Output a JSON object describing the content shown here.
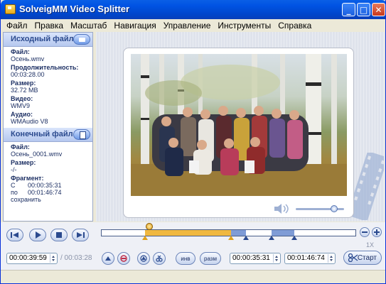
{
  "window": {
    "title": "SolveigMM Video Splitter",
    "controls": {
      "minimize": "_",
      "maximize": "□",
      "close": "✕"
    }
  },
  "menu": [
    "Файл",
    "Правка",
    "Масштаб",
    "Навигация",
    "Управление",
    "Инструменты",
    "Справка"
  ],
  "source": {
    "header": "Исходный файл",
    "file_label": "Файл:",
    "file_value": "Осень.wmv",
    "duration_label": "Продолжительность:",
    "duration_value": "00:03:28.00",
    "size_label": "Размер:",
    "size_value": "32.72 MB",
    "video_label": "Видео:",
    "video_value": "WMV9",
    "audio_label": "Аудио:",
    "audio_value": "WMAudio V8"
  },
  "output": {
    "header": "Конечный файл",
    "file_label": "Файл:",
    "file_value": "Осень_0001.wmv",
    "size_label": "Размер:",
    "size_value": "-/-",
    "fragment_label": "Фрагмент:",
    "from_prefix": "С",
    "from_value": "00:00:35:31",
    "to_prefix": "по",
    "to_value": "00:01:46:74",
    "action": "сохранить"
  },
  "playback": {
    "current_time": "00:00:39:59",
    "total_time": "/ 00:03:28",
    "fragment_start": "00:00:35:31",
    "fragment_end": "00:01:46:74",
    "invert_label": "инв",
    "split_label": "разм",
    "zoom_label": "1X",
    "start_label": "Старт",
    "volume_level": 0.8
  },
  "timeline": {
    "playhead": 0.19,
    "selection_start": 0.17,
    "selection_end": 0.51,
    "segments": [
      {
        "start": 0.17,
        "end": 0.51,
        "color": "#f0b840"
      },
      {
        "start": 0.51,
        "end": 0.57,
        "color": "#7f9cd6"
      },
      {
        "start": 0.67,
        "end": 0.76,
        "color": "#7f9cd6"
      }
    ],
    "markers": [
      {
        "pos": 0.17,
        "color": "orange"
      },
      {
        "pos": 0.51,
        "color": "orange"
      },
      {
        "pos": 0.57,
        "color": "blue"
      },
      {
        "pos": 0.67,
        "color": "blue"
      },
      {
        "pos": 0.76,
        "color": "blue"
      }
    ]
  },
  "colors": {
    "accent": "#2b4a8e",
    "selection": "#f0b840",
    "titlebar": "#0053e3"
  }
}
